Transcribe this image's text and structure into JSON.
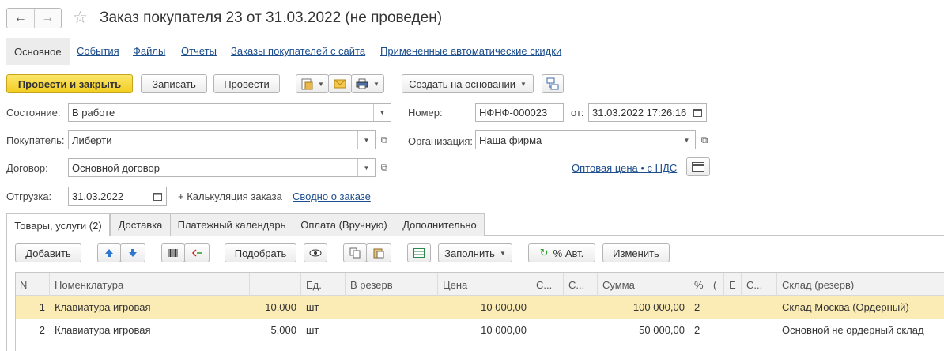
{
  "header": {
    "back": "←",
    "forward": "→",
    "star": "☆",
    "title": "Заказ покупателя 23 от 31.03.2022 (не проведен)"
  },
  "sections": [
    {
      "label": "Основное"
    },
    {
      "label": "События"
    },
    {
      "label": "Файлы"
    },
    {
      "label": "Отчеты"
    },
    {
      "label": "Заказы покупателей с сайта"
    },
    {
      "label": "Примененные автоматические скидки"
    }
  ],
  "toolbar": {
    "post_close": "Провести и закрыть",
    "write": "Записать",
    "post": "Провести",
    "create_based": "Создать на основании"
  },
  "form": {
    "state_label": "Состояние:",
    "state_value": "В работе",
    "buyer_label": "Покупатель:",
    "buyer_value": "Либерти",
    "contract_label": "Договор:",
    "contract_value": "Основной договор",
    "shipment_label": "Отгрузка:",
    "shipment_value": "31.03.2022",
    "calc_link": "+ Калькуляция заказа",
    "summary_link": "Сводно о заказе",
    "number_label": "Номер:",
    "number_value": "НФНФ-000023",
    "from_label": "от:",
    "date_value": "31.03.2022 17:26:16",
    "org_label": "Организация:",
    "org_value": "Наша фирма",
    "price_link": "Оптовая цена • с НДС"
  },
  "tabs": [
    {
      "label": "Товары, услуги (2)"
    },
    {
      "label": "Доставка"
    },
    {
      "label": "Платежный календарь"
    },
    {
      "label": "Оплата (Вручную)"
    },
    {
      "label": "Дополнительно"
    }
  ],
  "table_toolbar": {
    "add": "Добавить",
    "pick": "Подобрать",
    "fill": "Заполнить",
    "auto": "% Авт.",
    "change": "Изменить"
  },
  "columns": [
    "N",
    "Номенклатура",
    "",
    "Ед.",
    "В резерв",
    "Цена",
    "С...",
    "С...",
    "Сумма",
    "%",
    "(",
    "Е",
    "С...",
    "Склад (резерв)"
  ],
  "rows": [
    {
      "n": "1",
      "item": "Клавиатура игровая",
      "qty": "10,000",
      "unit": "шт",
      "price": "10 000,00",
      "sum": "100 000,00",
      "vat": "2",
      "warehouse": "Склад Москва (Ордерный)"
    },
    {
      "n": "2",
      "item": "Клавиатура игровая",
      "qty": "5,000",
      "unit": "шт",
      "price": "10 000,00",
      "sum": "50 000,00",
      "vat": "2",
      "warehouse": "Основной не ордерный склад"
    }
  ],
  "colors": {
    "accent": "#f2cd20",
    "link": "#1c4d8c",
    "selected_row": "#fbecb5"
  }
}
